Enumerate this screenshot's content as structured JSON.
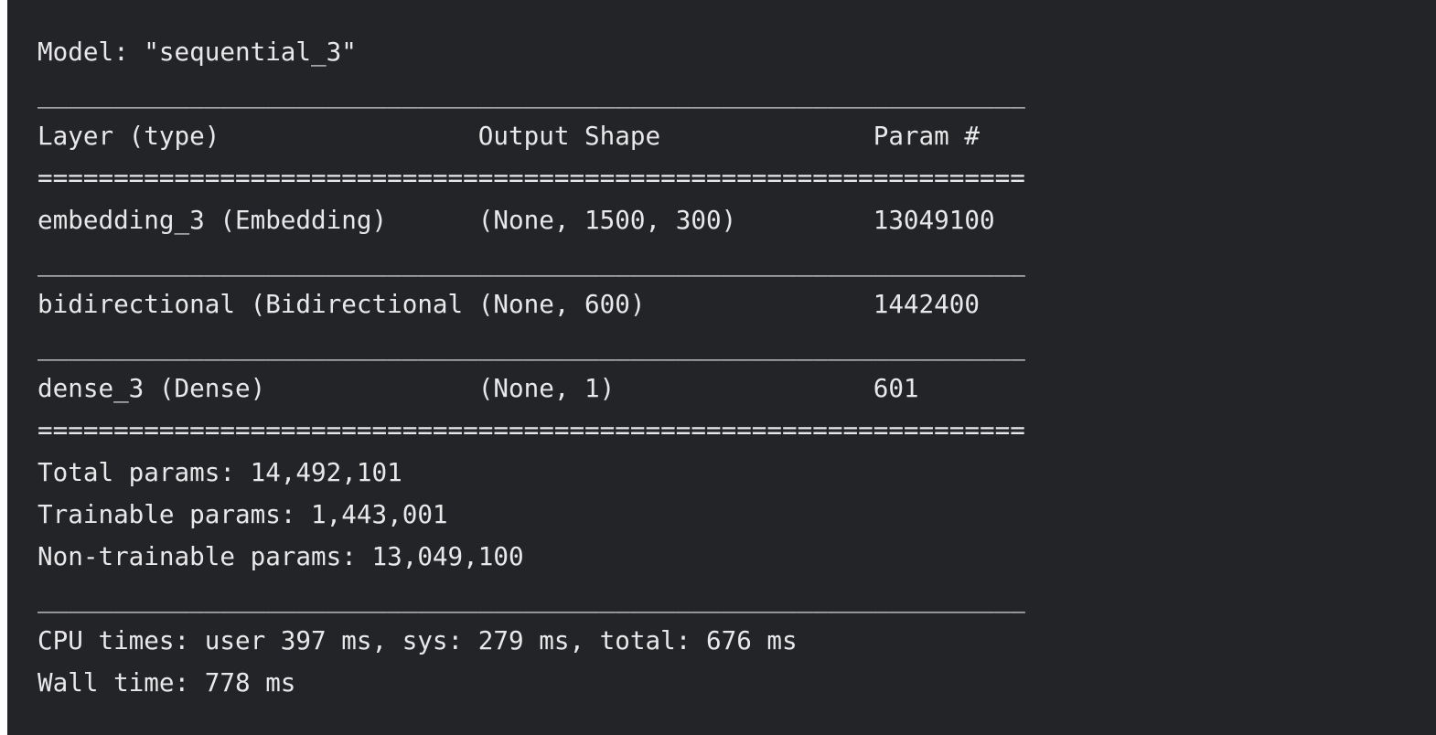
{
  "output": {
    "model_title": "Model: \"sequential_3\"",
    "rule_dash": "_________________________________________________________________",
    "rule_equals": "=================================================================",
    "header_row": "Layer (type)                 Output Shape              Param #   ",
    "layers": [
      "embedding_3 (Embedding)      (None, 1500, 300)         13049100  ",
      "bidirectional (Bidirectional (None, 600)               1442400   ",
      "dense_3 (Dense)              (None, 1)                 601       "
    ],
    "total_params": "Total params: 14,492,101",
    "trainable_params": "Trainable params: 1,443,001",
    "non_trainable_params": "Non-trainable params: 13,049,100",
    "cpu_times": "CPU times: user 397 ms, sys: 279 ms, total: 676 ms",
    "wall_time": "Wall time: 778 ms"
  },
  "colors": {
    "panel_background": "#232428",
    "text": "#e8e8e8"
  }
}
